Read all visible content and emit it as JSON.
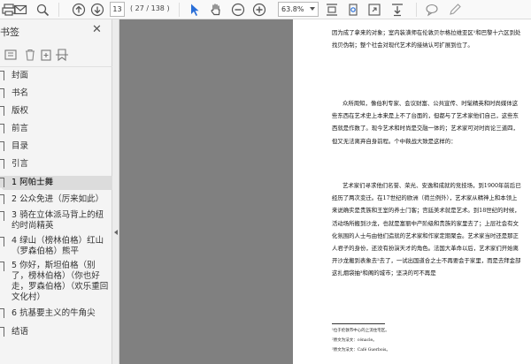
{
  "toolbar": {
    "page_number": "13",
    "page_count": "( 27 / 138 )",
    "zoom": "63.8%"
  },
  "sidebar": {
    "title": "书签",
    "bookmarks": [
      {
        "label": "封面"
      },
      {
        "label": "书名"
      },
      {
        "label": "版权"
      },
      {
        "label": "前言"
      },
      {
        "label": "目录"
      },
      {
        "label": "引言"
      },
      {
        "label": "1 阿帕士舞"
      },
      {
        "label": "2 公众免进（厉来如此）"
      },
      {
        "label": "3 骑在立体派马背上的纽约时尚精英"
      },
      {
        "label": "4 绿山（榜林伯格）红山（罗森伯格）熊平"
      },
      {
        "label": "5 你好，斯坦伯格（别了，榜林伯格）（你也好走，罗森伯格）（欢乐重回文化村）"
      },
      {
        "label": "6 抗基要主义的牛角尖"
      },
      {
        "label": "结语"
      }
    ]
  },
  "document": {
    "paragraphs": [
      "因为成了拿来的对象；室内装潢师在伦敦贝尔格拉维亚区¹和巴黎十六区到处找贝伪制；整个社会对现代艺术的接纳认可扩展到位了。",
      "众所周知，像伯利专家、会议财富、公共宣传、时髦精英和时尚媒体这些东西在艺术史上本来是上不了台面的，但都与了艺术家他们自己，这些东西就是作数了。现今艺术和时尚是交融一体的；艺术家可对时尚论三道四，但又无法离弃自身前程。个中鞅战大致是这样的：",
      "艺术家们寻求他们名誉、荣光、安逸和成就的竞技场，到1900年前后已经历了两次变迁。在17世纪的欧洲（荷兰例外），艺术家从精神上和本领上来说确实是贵族和王室的养士门客；宫廷美术就是艺术。到18世纪的时候，活动场所搬到沙龙，也就是富丽中产阶级和贵族的家里去了；上层社会有文化氛围的人士与由他们造就的艺术家和作家定期聚会。艺术家当时还是那正人君子的身份，还没有扮演天才的角色。法国大革命以后，艺术家们开始离开沙龙搬到表象去²去了，一试出国道合之士不再要会于家里，而是去拜金部这扎烟袋抽³和阁的城市；坚决的可不再是"
    ],
    "footnotes": [
      "¹位于伦敦市中心的上流住宅区。",
      "²原文为法文：cénacle。",
      "³原文为法文：Café Guerbois。"
    ]
  }
}
